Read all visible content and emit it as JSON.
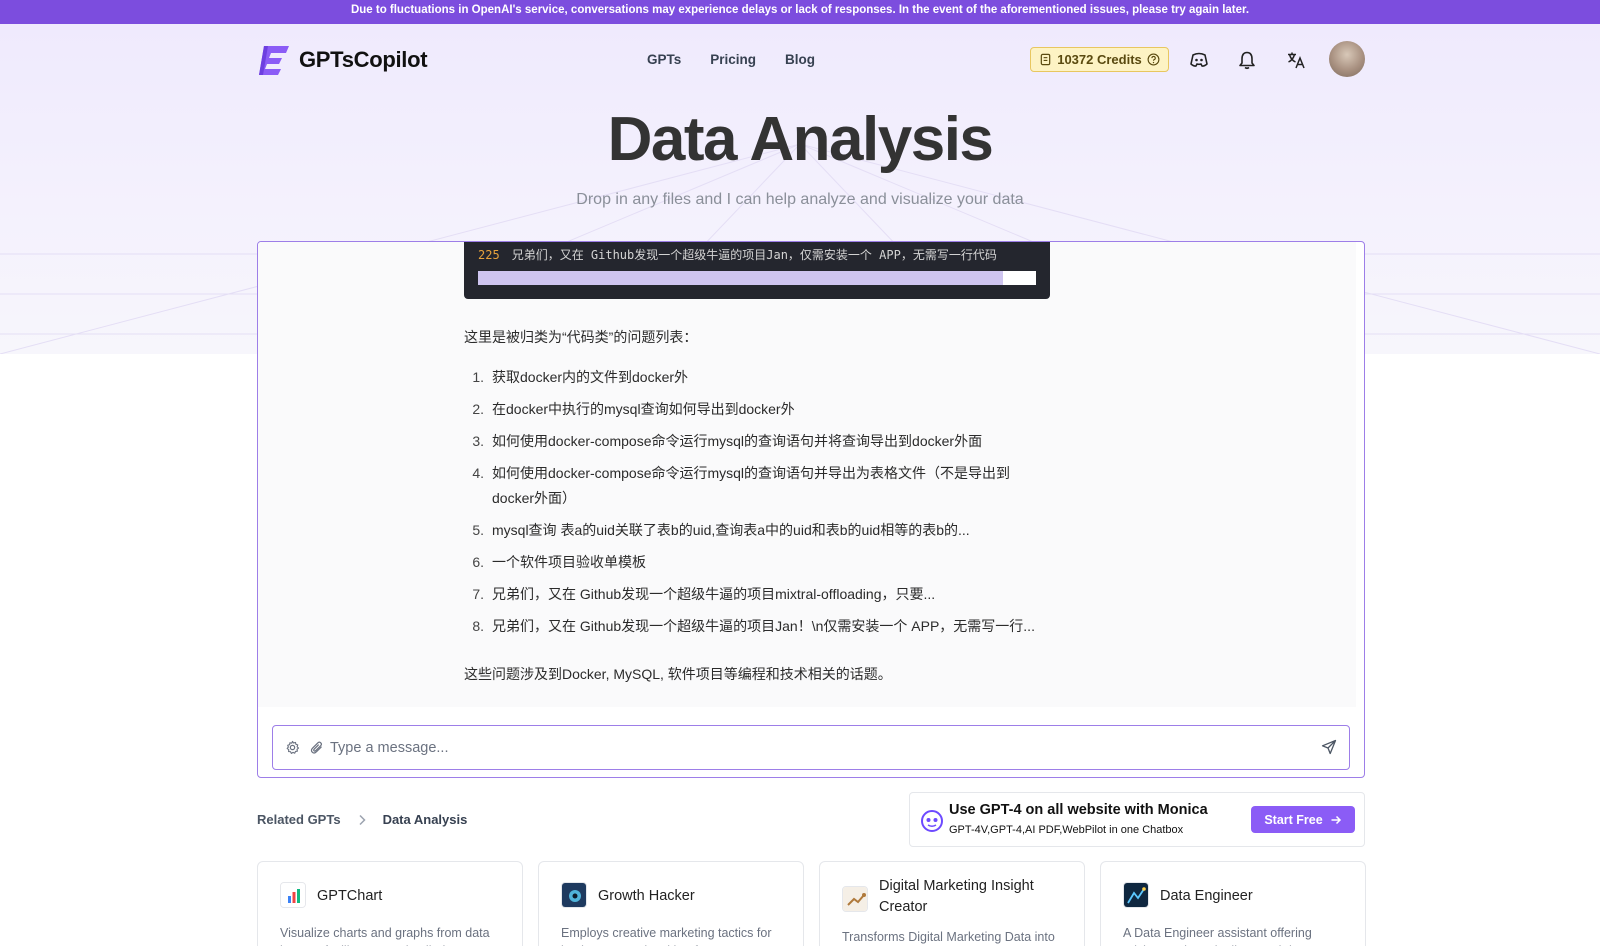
{
  "banner": {
    "text": "Due to fluctuations in OpenAI's service, conversations may experience delays or lack of responses. In the event of the aforementioned issues, please try again later."
  },
  "header": {
    "brand": "GPTsCopilot",
    "nav": [
      "GPTs",
      "Pricing",
      "Blog"
    ],
    "credits": "10372 Credits"
  },
  "hero": {
    "title": "Data Analysis",
    "subtitle": "Drop in any files and I can help analyze and visualize your data"
  },
  "chat": {
    "code_line_number": "225",
    "code_line_text": "兄弟们，又在 Github发现一个超级牛逼的项目Jan，仅需安装一个 APP，无需写一行代码",
    "intro": "这里是被归类为“代码类”的问题列表：",
    "items": [
      {
        "num": "1.",
        "text": "获取docker内的文件到docker外"
      },
      {
        "num": "2.",
        "text": "在docker中执行的mysql查询如何导出到docker外"
      },
      {
        "num": "3.",
        "text": "如何使用docker-compose命令运行mysql的查询语句并将查询导出到docker外面"
      },
      {
        "num": "4.",
        "text": "如何使用docker-compose命令运行mysql的查询语句并导出为表格文件（不是导出到docker外面）"
      },
      {
        "num": "5.",
        "text": "mysql查询 表a的uid关联了表b的uid,查询表a中的uid和表b的uid相等的表b的..."
      },
      {
        "num": "6.",
        "text": "一个软件项目验收单模板"
      },
      {
        "num": "7.",
        "text": "兄弟们，又在 Github发现一个超级牛逼的项目mixtral-offloading，只要..."
      },
      {
        "num": "8.",
        "text": "兄弟们，又在 Github发现一个超级牛逼的项目Jan！\\n仅需安装一个 APP，无需写一行..."
      }
    ],
    "outro": "这些问题涉及到Docker, MySQL, 软件项目等编程和技术相关的话题。",
    "input_placeholder": "Type a message..."
  },
  "breadcrumb": {
    "root": "Related GPTs",
    "current": "Data Analysis"
  },
  "promo": {
    "title": "Use GPT-4 on all website with Monica",
    "subtitle": "GPT-4V,GPT-4,AI PDF,WebPilot in one Chatbox",
    "button": "Start Free"
  },
  "related": [
    {
      "name": "GPTChart",
      "desc": "Visualize charts and graphs from data input to facilitate your detailed",
      "icon": "chart-icon"
    },
    {
      "name": "Growth Hacker",
      "desc": "Employs creative marketing tactics for business growth, with a focus on",
      "icon": "growth-icon"
    },
    {
      "name": "Digital Marketing Insight Creator",
      "desc": "Transforms Digital Marketing Data into",
      "icon": "marketing-icon"
    },
    {
      "name": "Data Engineer",
      "desc": "A Data Engineer assistant offering advice on data pipelines and data",
      "icon": "engineer-icon"
    }
  ],
  "colors": {
    "accent": "#8b5cf6",
    "banner": "#7c4dde",
    "credits_bg": "#fdf3c4"
  }
}
